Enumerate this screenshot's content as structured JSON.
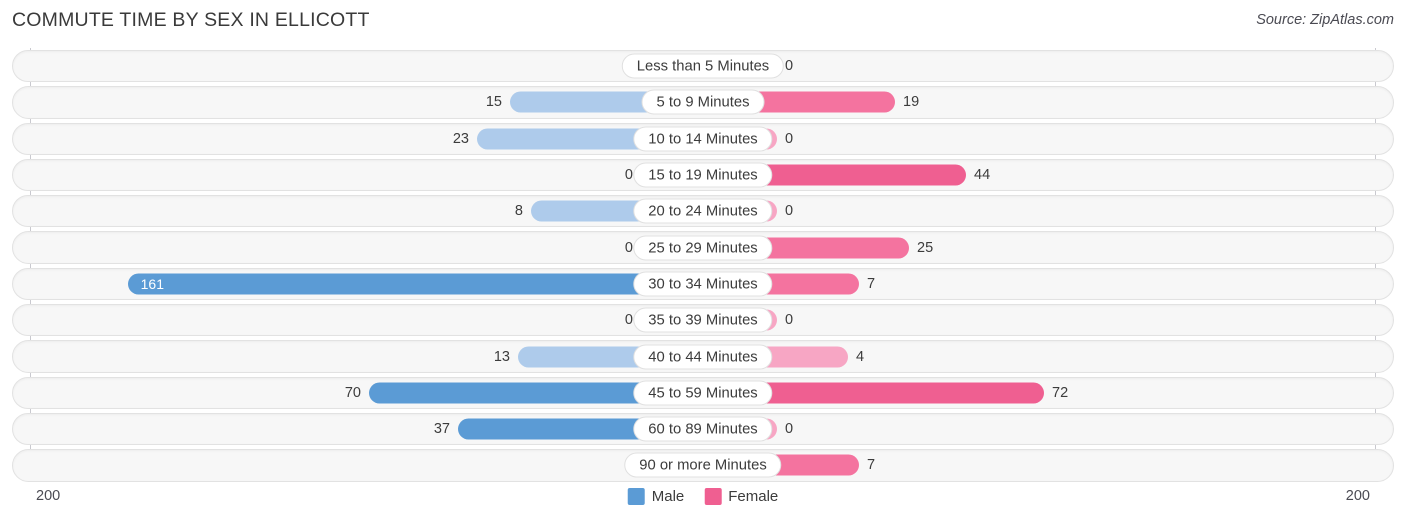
{
  "header": {
    "title": "COMMUTE TIME BY SEX IN ELLICOTT",
    "source": "Source: ZipAtlas.com"
  },
  "footer": {
    "axis_left": "200",
    "axis_right": "200"
  },
  "legend": {
    "items": [
      {
        "label": "Male",
        "color": "#5b9bd5"
      },
      {
        "label": "Female",
        "color": "#ef5f91"
      }
    ]
  },
  "chart_data": {
    "type": "bar",
    "orientation": "horizontal-diverging",
    "title": "COMMUTE TIME BY SEX IN ELLICOTT",
    "source": "Source: ZipAtlas.com",
    "xlabel": "",
    "ylabel": "",
    "xlim": [
      200,
      200
    ],
    "axis_ticks": [
      "200",
      "200"
    ],
    "grid": false,
    "legend_position": "bottom-center",
    "categories": [
      "Less than 5 Minutes",
      "5 to 9 Minutes",
      "10 to 14 Minutes",
      "15 to 19 Minutes",
      "20 to 24 Minutes",
      "25 to 29 Minutes",
      "30 to 34 Minutes",
      "35 to 39 Minutes",
      "40 to 44 Minutes",
      "45 to 59 Minutes",
      "60 to 89 Minutes",
      "90 or more Minutes"
    ],
    "series": [
      {
        "name": "Male",
        "color": "#5b9bd5",
        "values": [
          0,
          15,
          23,
          0,
          8,
          0,
          161,
          0,
          13,
          70,
          37,
          0
        ]
      },
      {
        "name": "Female",
        "color": "#ef5f91",
        "values": [
          0,
          19,
          0,
          44,
          0,
          25,
          7,
          0,
          4,
          72,
          0,
          7
        ]
      }
    ]
  },
  "rows": [
    {
      "label": "Less than 5 Minutes",
      "male": "0",
      "female": "0",
      "male_w": 62,
      "female_w": 74,
      "male_tone": "lo",
      "female_tone": "lo",
      "male_inside": false
    },
    {
      "label": "5 to 9 Minutes",
      "male": "15",
      "female": "19",
      "male_w": 193,
      "female_w": 192,
      "male_tone": "lo",
      "female_tone": "md",
      "male_inside": false
    },
    {
      "label": "10 to 14 Minutes",
      "male": "23",
      "female": "0",
      "male_w": 226,
      "female_w": 74,
      "male_tone": "lo",
      "female_tone": "lo",
      "male_inside": false
    },
    {
      "label": "15 to 19 Minutes",
      "male": "0",
      "female": "44",
      "male_w": 62,
      "female_w": 263,
      "male_tone": "lo",
      "female_tone": "hi",
      "male_inside": false
    },
    {
      "label": "20 to 24 Minutes",
      "male": "8",
      "female": "0",
      "male_w": 172,
      "female_w": 74,
      "male_tone": "lo",
      "female_tone": "lo",
      "male_inside": false
    },
    {
      "label": "25 to 29 Minutes",
      "male": "0",
      "female": "25",
      "male_w": 62,
      "female_w": 206,
      "male_tone": "lo",
      "female_tone": "md",
      "male_inside": false
    },
    {
      "label": "30 to 34 Minutes",
      "male": "161",
      "female": "7",
      "male_w": 575,
      "female_w": 156,
      "male_tone": "hi",
      "female_tone": "md",
      "male_inside": true
    },
    {
      "label": "35 to 39 Minutes",
      "male": "0",
      "female": "0",
      "male_w": 62,
      "female_w": 74,
      "male_tone": "lo",
      "female_tone": "lo",
      "male_inside": false
    },
    {
      "label": "40 to 44 Minutes",
      "male": "13",
      "female": "4",
      "male_w": 185,
      "female_w": 145,
      "male_tone": "lo",
      "female_tone": "lo",
      "male_inside": false
    },
    {
      "label": "45 to 59 Minutes",
      "male": "70",
      "female": "72",
      "male_w": 334,
      "female_w": 341,
      "male_tone": "hi",
      "female_tone": "hi",
      "male_inside": false
    },
    {
      "label": "60 to 89 Minutes",
      "male": "37",
      "female": "0",
      "male_w": 245,
      "female_w": 74,
      "male_tone": "hi",
      "female_tone": "lo",
      "male_inside": false
    },
    {
      "label": "90 or more Minutes",
      "male": "0",
      "female": "7",
      "male_w": 62,
      "female_w": 156,
      "male_tone": "lo",
      "female_tone": "md",
      "male_inside": false
    }
  ]
}
